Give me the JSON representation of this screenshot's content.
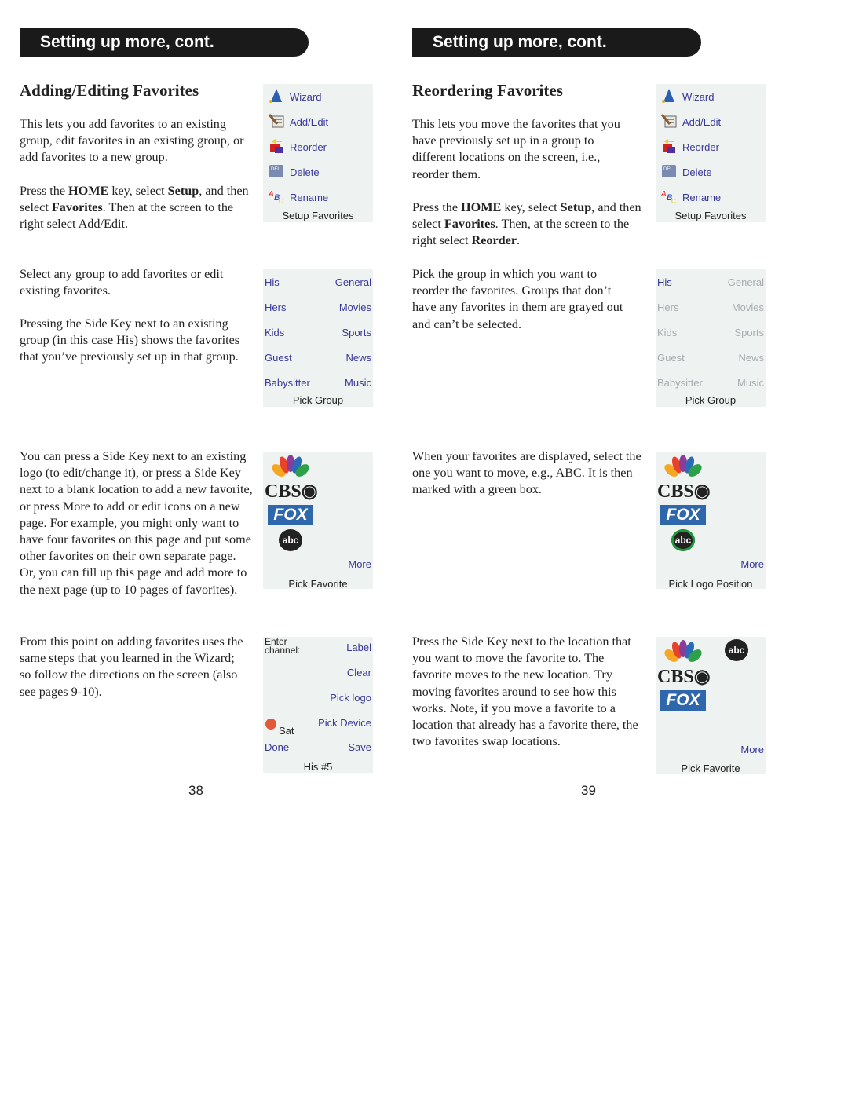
{
  "left": {
    "header": "Setting up more, cont.",
    "heading": "Adding/Editing Favorites",
    "paragraphs": [
      [
        {
          "t": "This lets you add favorites to an existing group, edit favorites in an existing group, or add favorites to a new group."
        }
      ],
      [
        {
          "t": "Press the "
        },
        {
          "t": "HOME",
          "b": true
        },
        {
          "t": " key, select "
        },
        {
          "t": "Setup",
          "b": true
        },
        {
          "t": ", and then select "
        },
        {
          "t": "Favorites",
          "b": true
        },
        {
          "t": ". Then at the screen to the right select Add/Edit."
        }
      ],
      [
        {
          "t": "Select any group to add favorites or edit existing favorites."
        }
      ],
      [
        {
          "t": "Pressing the Side Key next to an existing group (in this case His) shows the favorites that you’ve previously set up in that group."
        }
      ],
      [
        {
          "t": "You can press a Side Key next to an existing logo (to edit/change it), or press a Side Key next to a blank location to add a new favorite, or press More to add or edit icons on a new page. For example, you might only want to have four favorites on this page and put some other favorites on their own separate page. Or, you can fill up this page and add more to the next page (up to 10 pages of favorites)."
        }
      ],
      [
        {
          "t": "From this point on adding favorites uses the same steps that you learned in the Wizard; so follow the directions on the screen (also see pages 9-10)."
        }
      ]
    ],
    "page_number": "38",
    "menu": {
      "items": [
        "Wizard",
        "Add/Edit",
        "Reorder",
        "Delete",
        "Rename"
      ],
      "caption": "Setup Favorites"
    },
    "groups": {
      "rows": [
        [
          "His",
          "General"
        ],
        [
          "Hers",
          "Movies"
        ],
        [
          "Kids",
          "Sports"
        ],
        [
          "Guest",
          "News"
        ],
        [
          "Babysitter",
          "Music"
        ]
      ],
      "caption": "Pick Group"
    },
    "logos": {
      "more": "More",
      "caption": "Pick Favorite"
    },
    "channel": {
      "enter": "Enter channel:",
      "label": "Label",
      "clear": "Clear",
      "pick_logo": "Pick logo",
      "device": "Sat",
      "pick_device": "Pick Device",
      "done": "Done",
      "save": "Save",
      "caption": "His #5"
    }
  },
  "right": {
    "header": "Setting up more, cont.",
    "heading": "Reordering Favorites",
    "paragraphs": [
      [
        {
          "t": "This lets you move the favorites that you have previously set up in a group to different locations on the screen, i.e., reorder them."
        }
      ],
      [
        {
          "t": "Press the "
        },
        {
          "t": "HOME",
          "b": true
        },
        {
          "t": " key, select "
        },
        {
          "t": "Setup",
          "b": true
        },
        {
          "t": ", and then select "
        },
        {
          "t": "Favorites",
          "b": true
        },
        {
          "t": ". Then, at the screen to the right select "
        },
        {
          "t": "Reorder",
          "b": true
        },
        {
          "t": "."
        }
      ],
      [
        {
          "t": "Pick the group in which you want to reorder the favorites. Groups that don’t have any favorites in them are grayed out and can’t be selected."
        }
      ],
      [
        {
          "t": "When your favorites are displayed, select the one you want to move, e.g., ABC. It is then marked with a green box."
        }
      ],
      [
        {
          "t": "Press the Side Key next to the location that you want to move the favorite to. The favorite moves to the new location. Try moving favorites around to see how this works. Note, if you move a favorite to a location that already has a favorite there, the two favorites swap locations."
        }
      ]
    ],
    "page_number": "39",
    "menu": {
      "items": [
        "Wizard",
        "Add/Edit",
        "Reorder",
        "Delete",
        "Rename"
      ],
      "caption": "Setup Favorites"
    },
    "groups": {
      "rows": [
        [
          "His",
          "General"
        ],
        [
          "Hers",
          "Movies"
        ],
        [
          "Kids",
          "Sports"
        ],
        [
          "Guest",
          "News"
        ],
        [
          "Babysitter",
          "Music"
        ]
      ],
      "caption": "Pick Group"
    },
    "logos": {
      "more": "More",
      "caption": "Pick Logo Position"
    },
    "moved": {
      "more": "More",
      "caption": "Pick Favorite"
    }
  },
  "logo_text": {
    "cbs": "CBS",
    "fox": "FOX",
    "abc": "abc"
  },
  "colors": {
    "menu_text": "#38389a",
    "screen_bg": "#eef2f1",
    "grayed": "#a8acb0",
    "selected_box": "#1f9a3a"
  }
}
